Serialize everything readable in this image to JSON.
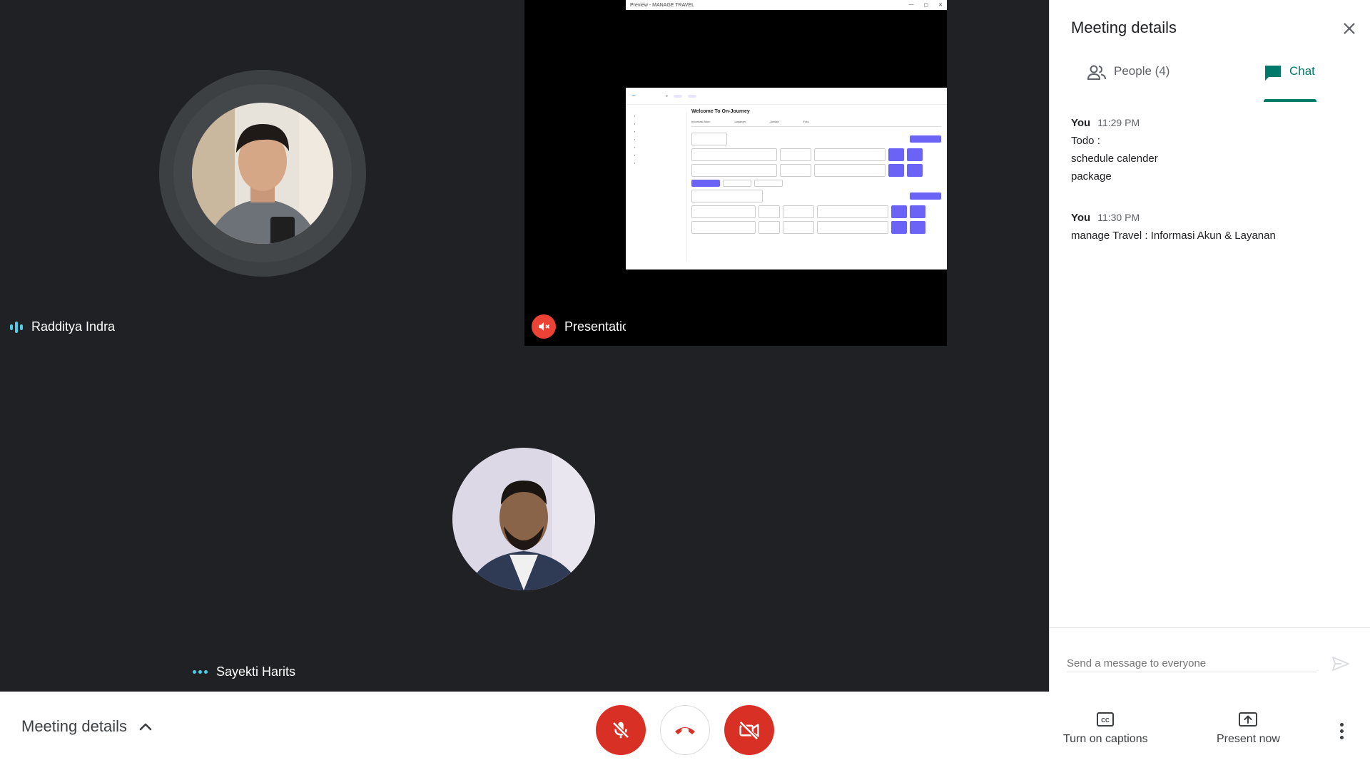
{
  "tiles": {
    "raddit": {
      "name": "Radditya Indra"
    },
    "presentation": {
      "name": "Presentation (Radditya Indra)",
      "window_title": "Preview - MANAGE TRAVEL",
      "screen_title": "Welcome To On-Journey",
      "tabs": [
        "Informasi Akun",
        "Layanan",
        "Jumlah",
        "Foto"
      ]
    },
    "sayekti": {
      "name": "Sayekti Harits"
    }
  },
  "panel": {
    "title": "Meeting details",
    "tabs": {
      "people": "People (4)",
      "chat": "Chat"
    },
    "messages": [
      {
        "sender": "You",
        "time": "11:29 PM",
        "lines": [
          "Todo :",
          "schedule calender",
          "package"
        ]
      },
      {
        "sender": "You",
        "time": "11:30 PM",
        "lines": [
          "manage Travel : Informasi Akun & Layanan"
        ]
      }
    ],
    "compose_placeholder": "Send a message to everyone"
  },
  "bottom": {
    "meeting_details": "Meeting details",
    "captions": "Turn on captions",
    "present": "Present now"
  },
  "colors": {
    "accent_teal": "#00796b",
    "danger_red": "#d93025",
    "speaking_cyan": "#4ecde6"
  }
}
